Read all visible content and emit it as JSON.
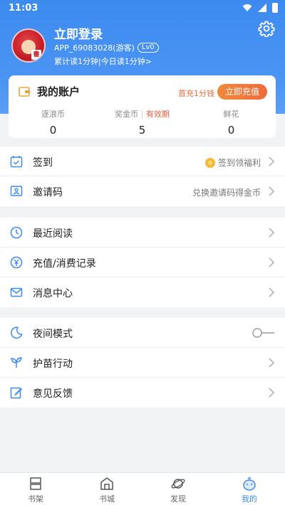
{
  "status_bar": {
    "time": "11:03"
  },
  "profile": {
    "title": "立即登录",
    "user_id": "APP_69083028(游客)",
    "level": "Lv0",
    "read_stats": "累计读1分钟|今日读1分钟>"
  },
  "account": {
    "title": "我的账户",
    "first_recharge": "首充1分钱",
    "recharge_button": "立即充值",
    "stats": [
      {
        "label": "逐浪币",
        "value": "0"
      },
      {
        "label": "奖金币",
        "extra": "有效期",
        "value": "5"
      },
      {
        "label": "鲜花",
        "value": "0"
      }
    ]
  },
  "menu_group_1": [
    {
      "label": "签到",
      "right_text": "签到领福利"
    },
    {
      "label": "邀请码",
      "right_text": "兑换邀请码得金币"
    }
  ],
  "menu_group_2": [
    {
      "label": "最近阅读"
    },
    {
      "label": "充值/消费记录"
    },
    {
      "label": "消息中心"
    }
  ],
  "menu_group_3": [
    {
      "label": "夜间模式",
      "toggle": "off"
    },
    {
      "label": "护苗行动"
    },
    {
      "label": "意见反馈"
    }
  ],
  "bottom_nav": [
    {
      "label": "书架",
      "icon": "bookshelf-icon"
    },
    {
      "label": "书城",
      "icon": "bookstore-icon"
    },
    {
      "label": "发现",
      "icon": "discover-icon"
    },
    {
      "label": "我的",
      "icon": "profile-icon",
      "active": true
    }
  ],
  "colors": {
    "accent": "#3d8bf0",
    "header_blue": "#4a94f3",
    "orange": "#ef6a3b",
    "coin": "#f3b83c"
  }
}
